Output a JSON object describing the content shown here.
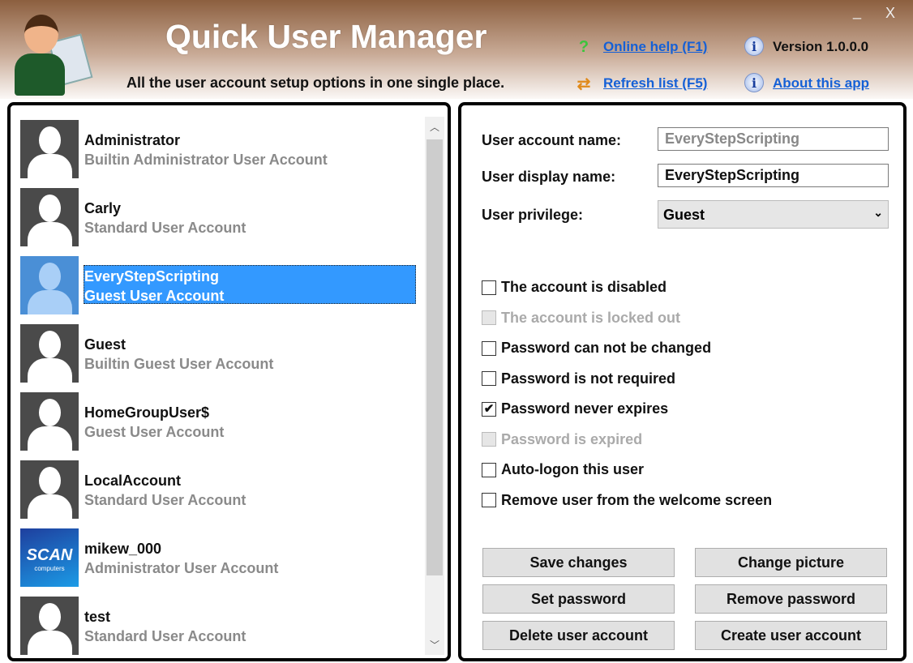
{
  "header": {
    "title": "Quick User Manager",
    "subtitle": "All the user account setup options in one single place.",
    "online_help": "Online help (F1)",
    "refresh": "Refresh list (F5)",
    "version": "Version 1.0.0.0",
    "about": "About this app",
    "minimize": "_",
    "close": "X"
  },
  "users": [
    {
      "name": "Administrator",
      "type": "Builtin Administrator User Account"
    },
    {
      "name": "Carly",
      "type": "Standard User Account"
    },
    {
      "name": "EveryStepScripting",
      "type": "Guest User Account",
      "selected": true
    },
    {
      "name": "Guest",
      "type": "Builtin Guest User Account"
    },
    {
      "name": "HomeGroupUser$",
      "type": "Guest User Account"
    },
    {
      "name": "LocalAccount",
      "type": "Standard User Account"
    },
    {
      "name": "mikew_000",
      "type": "Administrator User Account",
      "picture_text": "SCAN",
      "picture_subtext": "computers"
    },
    {
      "name": "test",
      "type": "Standard User Account"
    }
  ],
  "form": {
    "account_name_label": "User account name:",
    "account_name": "EveryStepScripting",
    "display_name_label": "User display name:",
    "display_name": "EveryStepScripting",
    "privilege_label": "User privilege:",
    "privilege": "Guest"
  },
  "options": [
    {
      "label": "The account is disabled",
      "checked": false,
      "enabled": true
    },
    {
      "label": "The account is locked out",
      "checked": false,
      "enabled": false
    },
    {
      "label": "Password can not be changed",
      "checked": false,
      "enabled": true
    },
    {
      "label": "Password is not required",
      "checked": false,
      "enabled": true
    },
    {
      "label": "Password never expires",
      "checked": true,
      "enabled": true
    },
    {
      "label": "Password is expired",
      "checked": false,
      "enabled": false
    },
    {
      "label": "Auto-logon this user",
      "checked": false,
      "enabled": true
    },
    {
      "label": "Remove user from the welcome screen",
      "checked": false,
      "enabled": true
    }
  ],
  "buttons": {
    "save": "Save changes",
    "change_picture": "Change picture",
    "set_password": "Set password",
    "remove_password": "Remove password",
    "delete": "Delete user account",
    "create": "Create user account"
  }
}
